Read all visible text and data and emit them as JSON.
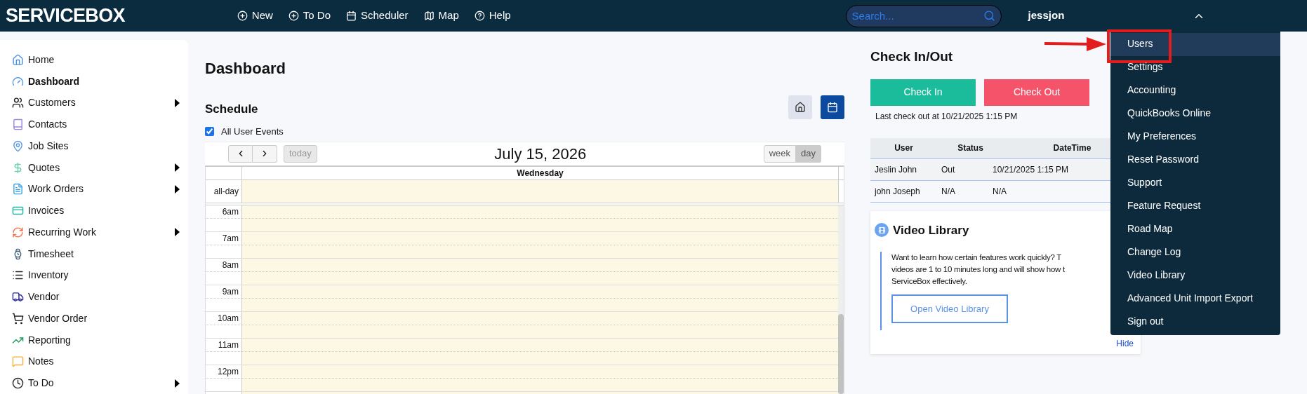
{
  "topbar": {
    "logo": "SERVICEBOX",
    "nav": [
      "New",
      "To Do",
      "Scheduler",
      "Map",
      "Help"
    ],
    "search": {
      "placeholder": "Search..."
    },
    "user": "jessjon",
    "user_menu_expanded": true
  },
  "sidebar": {
    "items": [
      {
        "label": "Home",
        "selected": false,
        "has_submenu": false
      },
      {
        "label": "Dashboard",
        "selected": true,
        "has_submenu": false
      },
      {
        "label": "Customers",
        "selected": false,
        "has_submenu": true
      },
      {
        "label": "Contacts",
        "selected": false,
        "has_submenu": false
      },
      {
        "label": "Job Sites",
        "selected": false,
        "has_submenu": false
      },
      {
        "label": "Quotes",
        "selected": false,
        "has_submenu": true
      },
      {
        "label": "Work Orders",
        "selected": false,
        "has_submenu": true
      },
      {
        "label": "Invoices",
        "selected": false,
        "has_submenu": false
      },
      {
        "label": "Recurring Work",
        "selected": false,
        "has_submenu": true
      },
      {
        "label": "Timesheet",
        "selected": false,
        "has_submenu": false
      },
      {
        "label": "Inventory",
        "selected": false,
        "has_submenu": false
      },
      {
        "label": "Vendor",
        "selected": false,
        "has_submenu": false
      },
      {
        "label": "Vendor Order",
        "selected": false,
        "has_submenu": false
      },
      {
        "label": "Reporting",
        "selected": false,
        "has_submenu": false
      },
      {
        "label": "Notes",
        "selected": false,
        "has_submenu": false
      },
      {
        "label": "To Do",
        "selected": false,
        "has_submenu": true
      }
    ]
  },
  "page_title": "Dashboard",
  "schedule": {
    "title": "Schedule",
    "view_buttons": [
      {
        "kind": "home",
        "selected": false
      },
      {
        "kind": "calendar",
        "selected": true
      }
    ],
    "all_user_events": {
      "label": "All User Events",
      "checked": true
    },
    "today_button": {
      "label": "today",
      "disabled": true
    },
    "date": "July 15, 2026",
    "range_tabs": [
      {
        "label": "week",
        "selected": false
      },
      {
        "label": "day",
        "selected": true
      }
    ],
    "day_header": "Wednesday",
    "all_day_label": "all-day",
    "hours": [
      "6am",
      "7am",
      "8am",
      "9am",
      "10am",
      "11am",
      "12pm"
    ]
  },
  "check_in_out": {
    "title": "Check In/Out",
    "check_in": "Check In",
    "check_out": "Check Out",
    "last": "Last check out at 10/21/2025 1:15 PM",
    "columns": [
      "User",
      "Status",
      "DateTime"
    ],
    "rows": [
      [
        "Jeslin John",
        "Out",
        "10/21/2025 1:15 PM"
      ],
      [
        "john Joseph",
        "N/A",
        "N/A"
      ]
    ]
  },
  "video_library": {
    "title": "Video Library",
    "lines": [
      "Want to learn how certain features work quickly? T",
      "videos are 1 to 10 minutes long and will show how t",
      "ServiceBox effectively."
    ],
    "button": "Open Video Library",
    "hide": "Hide"
  },
  "user_menu": [
    {
      "label": "Users",
      "selected": true,
      "callout": true
    },
    {
      "label": "Settings",
      "selected": false,
      "callout": false
    },
    {
      "label": "Accounting",
      "selected": false,
      "callout": false
    },
    {
      "label": "QuickBooks Online",
      "selected": false,
      "callout": false
    },
    {
      "label": "My Preferences",
      "selected": false,
      "callout": false
    },
    {
      "label": "Reset Password",
      "selected": false,
      "callout": false
    },
    {
      "label": "Support",
      "selected": false,
      "callout": false
    },
    {
      "label": "Feature Request",
      "selected": false,
      "callout": false
    },
    {
      "label": "Road Map",
      "selected": false,
      "callout": false
    },
    {
      "label": "Change Log",
      "selected": false,
      "callout": false
    },
    {
      "label": "Video Library",
      "selected": false,
      "callout": false
    },
    {
      "label": "Advanced Unit Import Export",
      "selected": false,
      "callout": false
    },
    {
      "label": "Sign out",
      "selected": false,
      "callout": false
    }
  ]
}
